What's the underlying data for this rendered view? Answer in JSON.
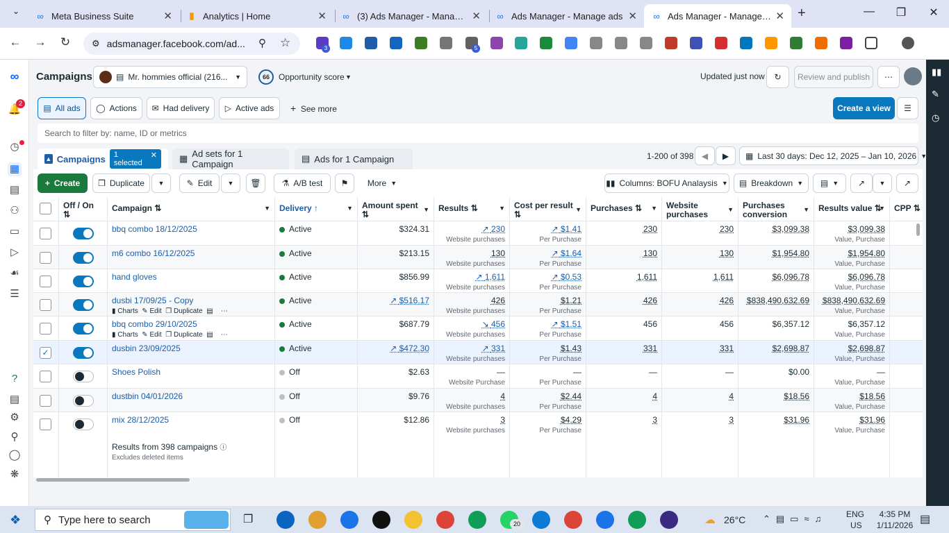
{
  "browser": {
    "tabs": [
      {
        "title": "Meta Business Suite",
        "icon": "meta-icon",
        "active": false
      },
      {
        "title": "Analytics | Home",
        "icon": "analytics-icon",
        "active": false
      },
      {
        "title": "(3) Ads Manager - Manage ads",
        "icon": "meta-icon",
        "active": false
      },
      {
        "title": "Ads Manager - Manage ads",
        "icon": "meta-icon",
        "active": false
      },
      {
        "title": "Ads Manager - Manage ads",
        "icon": "meta-icon",
        "active": true
      }
    ],
    "url": "adsmanager.facebook.com/ad...",
    "new_tab": "+",
    "ext_badge": "3",
    "ext_badge2": "5"
  },
  "rail": {
    "notif_count": "2"
  },
  "header": {
    "title": "Campaigns",
    "account": "Mr. hommies official (216...",
    "opp_score": "66",
    "opp_label": "Opportunity score",
    "updated": "Updated just now",
    "review": "Review and publish"
  },
  "filters": {
    "all_ads": "All ads",
    "actions": "Actions",
    "had_delivery": "Had delivery",
    "active_ads": "Active ads",
    "see_more": "See more",
    "create_view": "Create a view",
    "search_placeholder": "Search to filter by: name, ID or metrics"
  },
  "levels": {
    "campaigns": "Campaigns",
    "selected": "1 selected",
    "adsets": "Ad sets for 1 Campaign",
    "ads": "Ads for 1 Campaign",
    "pagination": "1-200 of 398",
    "daterange": "Last 30 days: Dec 12, 2025 – Jan 10, 2026"
  },
  "toolbar": {
    "create": "Create",
    "duplicate": "Duplicate",
    "edit": "Edit",
    "ab": "A/B test",
    "more": "More",
    "columns": "Columns: BOFU Analaysis",
    "breakdown": "Breakdown"
  },
  "columns": {
    "offon": "Off / On",
    "campaign": "Campaign",
    "delivery": "Delivery",
    "amount": "Amount spent",
    "results": "Results",
    "cpr": "Cost per result",
    "purchases": "Purchases",
    "wpurchases": "Website purchases",
    "pconv": "Purchases conversion val...",
    "rvalue": "Results value",
    "cpp": "CPP"
  },
  "rows": [
    {
      "name": "bbq combo 18/12/2025",
      "on": true,
      "delivery": "Active",
      "amount": "$324.31",
      "results": "230",
      "results_sub": "Website purchases",
      "cpr": "$1.41",
      "cpr_sub": "Per Purchase",
      "purchases": "230",
      "wp": "230",
      "pcv": "$3,099.38",
      "rv": "$3,099.38",
      "rv_sub": "Value, Purchase"
    },
    {
      "name": "m6 combo 16/12/2025",
      "on": true,
      "delivery": "Active",
      "amount": "$213.15",
      "results": "130",
      "results_sub": "Website purchases",
      "cpr": "$1.64",
      "cpr_sub": "Per Purchase",
      "purchases": "130",
      "wp": "130",
      "pcv": "$1,954.80",
      "rv": "$1,954.80",
      "rv_sub": "Value, Purchase"
    },
    {
      "name": "hand gloves",
      "on": true,
      "delivery": "Active",
      "amount": "$856.99",
      "results": "1,611",
      "results_sub": "Website purchases",
      "cpr": "$0.53",
      "cpr_sub": "Per Purchase",
      "purchases": "1,611",
      "wp": "1,611",
      "pcv": "$6,096.78",
      "rv": "$6,096.78",
      "rv_sub": "Value, Purchase"
    },
    {
      "name": "dusbi 17/09/25 - Copy",
      "on": true,
      "delivery": "Active",
      "amount": "$516.17",
      "results": "426",
      "results_sub": "Website purchases",
      "cpr": "$1.21",
      "cpr_sub": "Per Purchase",
      "purchases": "426",
      "wp": "426",
      "pcv": "$838,490,632.69",
      "rv": "$838,490,632.69",
      "rv_sub": "Value, Purchase",
      "actions": [
        "Charts",
        "Edit",
        "Duplicate"
      ]
    },
    {
      "name": "bbq combo 29/10/2025",
      "on": true,
      "delivery": "Active",
      "amount": "$687.79",
      "results": "456",
      "results_sub": "Website purchases",
      "cpr": "$1.51",
      "cpr_sub": "Per Purchase",
      "purchases": "456",
      "wp": "456",
      "pcv": "$6,357.12",
      "rv": "$6,357.12",
      "rv_sub": "Value, Purchase",
      "actions": [
        "Charts",
        "Edit",
        "Duplicate"
      ]
    },
    {
      "name": "dusbin 23/09/2025",
      "on": true,
      "selected": true,
      "delivery": "Active",
      "amount": "$472.30",
      "results": "331",
      "results_sub": "Website purchases",
      "cpr": "$1.43",
      "cpr_sub": "Per Purchase",
      "purchases": "331",
      "wp": "331",
      "pcv": "$2,698.87",
      "rv": "$2,698.87",
      "rv_sub": "Value, Purchase"
    },
    {
      "name": "Shoes Polish",
      "on": false,
      "delivery": "Off",
      "amount": "$2.63",
      "results": "—",
      "results_sub": "Website Purchase",
      "cpr": "—",
      "cpr_sub": "Per Purchase",
      "purchases": "—",
      "wp": "—",
      "pcv": "$0.00",
      "rv": "—",
      "rv_sub": "Value, Purchase"
    },
    {
      "name": "dustbin 04/01/2026",
      "on": false,
      "delivery": "Off",
      "amount": "$9.76",
      "results": "4",
      "results_sub": "Website purchases",
      "cpr": "$2.44",
      "cpr_sub": "Per Purchase",
      "purchases": "4",
      "wp": "4",
      "pcv": "$18.56",
      "rv": "$18.56",
      "rv_sub": "Value, Purchase"
    },
    {
      "name": "mix 28/12/2025",
      "on": false,
      "delivery": "Off",
      "amount": "$12.86",
      "results": "3",
      "results_sub": "Website purchases",
      "cpr": "$4.29",
      "cpr_sub": "Per Purchase",
      "purchases": "3",
      "wp": "3",
      "pcv": "$31.96",
      "rv": "$31.96",
      "rv_sub": "Value, Purchase"
    }
  ],
  "summary": {
    "title": "Results from 398 campaigns",
    "sub": "Excludes deleted items"
  },
  "taskbar": {
    "search": "Type here to search",
    "weather": "26°C",
    "lang": "ENG",
    "region": "US",
    "time": "4:35 PM",
    "date": "1/11/2026",
    "wa_badge": "20"
  }
}
